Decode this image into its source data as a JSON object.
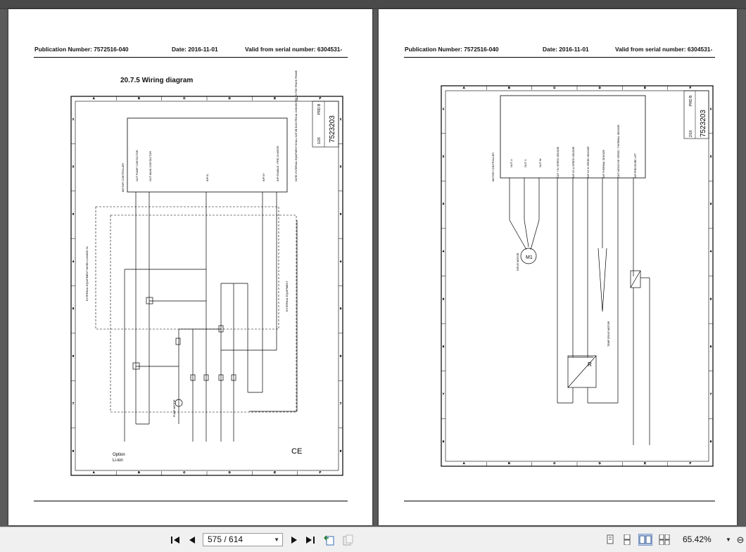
{
  "pages": {
    "left": {
      "publication": "Publication Number: 7572516-040",
      "date": "Date: 2016-11-01",
      "valid": "Valid from serial number: 6304531-",
      "section_title": "20.7.5 Wiring diagram",
      "drawing_number": "7523203",
      "sheet": "1/26",
      "revision": "PRD B",
      "grid_letters": [
        "A",
        "B",
        "C",
        "D",
        "E",
        "F"
      ],
      "grid_numbers": [
        "1",
        "2",
        "3",
        "4",
        "5",
        "6",
        "7",
        "8"
      ],
      "component_labels": {
        "controller": "MOTOR CONTROLLER",
        "controller_tag": "T1",
        "pump_contactor": "OUT PUMP CONTACTOR",
        "main_contactor": "OUT MAIN CONTACTOR",
        "b_minus": "INP B-",
        "b_plus": "INP B+",
        "enable": "INP ENABLE / PRE-CHARGE",
        "note": "NOTE: EXTERNAL EQUIPMENT SHALL NOT BE ELECTRICAL CONNECTED TO THE TRUCK FRAME",
        "ext_equipment_left": "EXTERNAL EQUIPMENT WHEN LOADED IN",
        "ext_equipment_right": "EXTERNAL EQUIPMENT",
        "pump_motor": "PUMP MOTOR",
        "option": "Option",
        "option_sub": "Li-ion",
        "ce": "CE"
      }
    },
    "right": {
      "publication": "Publication Number: 7572516-040",
      "date": "Date: 2016-11-01",
      "valid": "Valid from serial number: 6304531-",
      "drawing_number": "7523203",
      "sheet": "2/16",
      "revision": "PRD B",
      "grid_letters": [
        "A",
        "B",
        "C",
        "D",
        "E",
        "F"
      ],
      "grid_numbers": [
        "1",
        "2",
        "3",
        "4",
        "5",
        "6",
        "7",
        "8"
      ],
      "component_labels": {
        "controller": "MOTOR CONTROLLER",
        "out_u": "OUT U",
        "out_v": "OUT V",
        "out_w": "OUT W",
        "speed_sensor_out": "OUT +5V SPEED SENSOR",
        "speed_ch_a": "INP CH A SPEED SENSOR",
        "speed_ch_b": "INP CH B SPEED SENSOR",
        "thermal": "INP THERMAL SENSOR",
        "neg_speed": "OUT NEGATIVE SPEED / THERMAL SENSOR",
        "pressure_lift": "INP PRESSURE LIFT",
        "drive_motor": "DRIVE MOTOR",
        "motor_label": "M1",
        "temp_drive_motor": "TEMP DRIVE MOTOR",
        "sensor_r": "R"
      }
    }
  },
  "toolbar": {
    "first_icon": "first-page-icon",
    "prev_icon": "previous-page-icon",
    "page_value": "575 / 614",
    "next_icon": "next-page-icon",
    "last_icon": "last-page-icon",
    "zoom": "65.42%"
  }
}
